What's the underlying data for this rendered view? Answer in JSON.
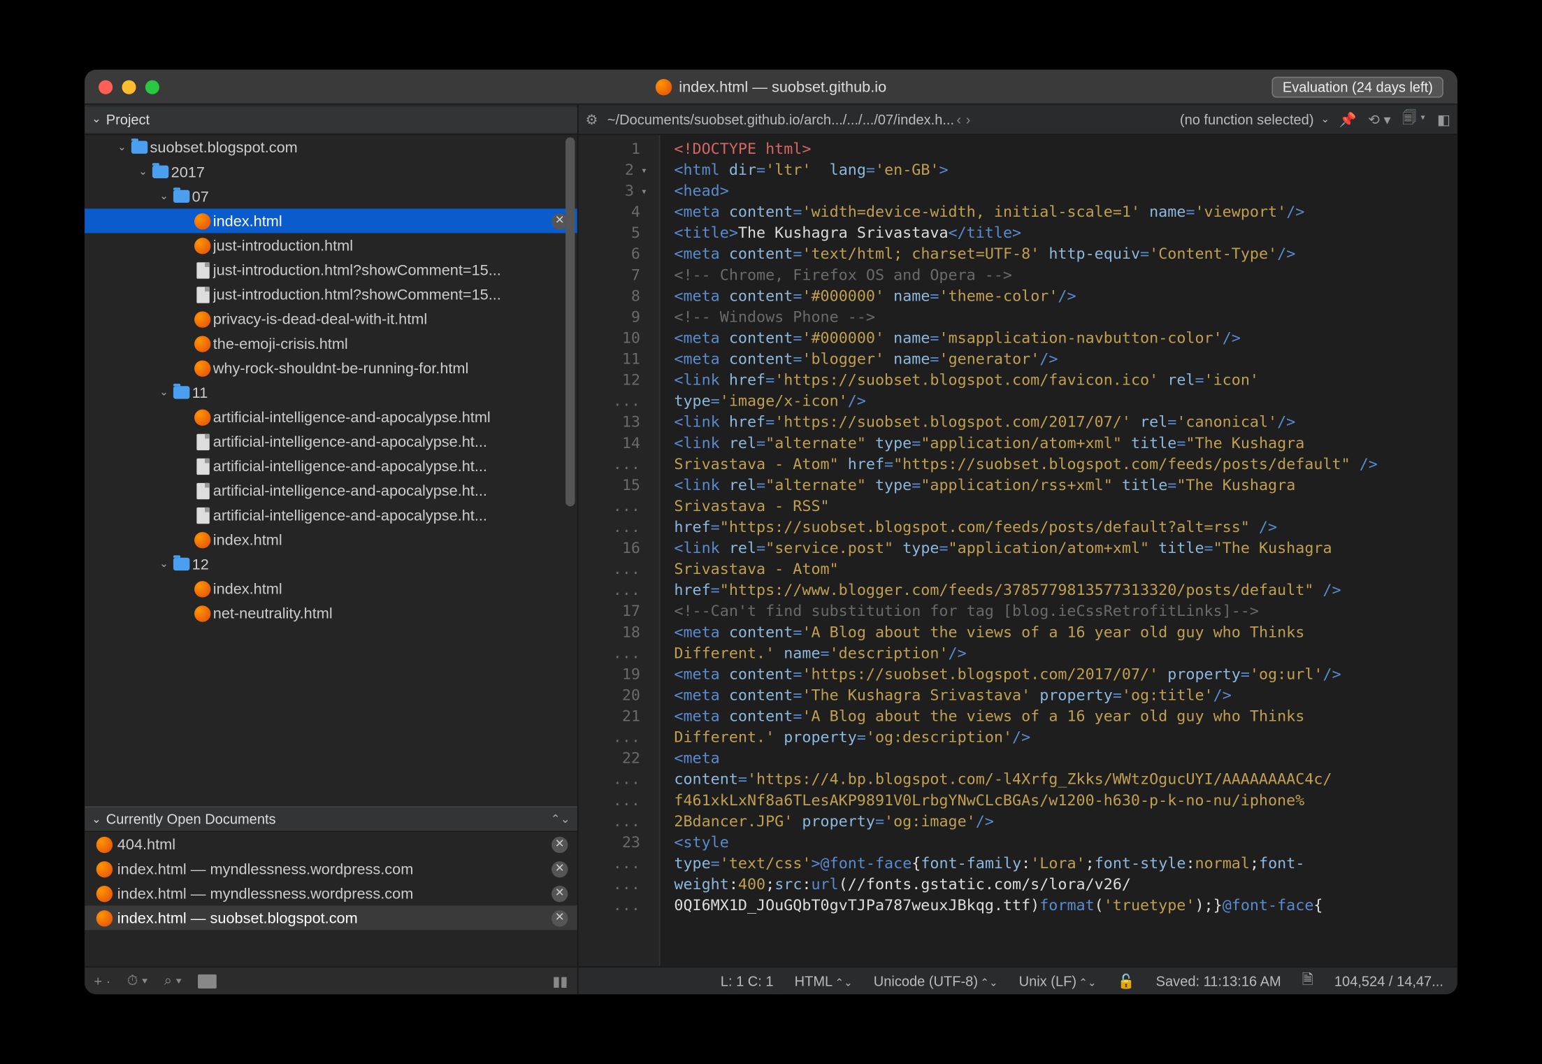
{
  "title": {
    "filename": "index.html",
    "project": "suobset.github.io"
  },
  "evaluation_badge": "Evaluation (24 days left)",
  "breadcrumb": "~/Documents/suobset.github.io/arch.../.../.../07/index.h...",
  "function_selector": "(no function selected)",
  "sidebar": {
    "project_label": "Project",
    "open_docs_label": "Currently Open Documents",
    "tree": [
      {
        "indent": 1,
        "type": "folder",
        "chev": "down",
        "label": "suobset.blogspot.com"
      },
      {
        "indent": 2,
        "type": "folder",
        "chev": "down",
        "label": "2017"
      },
      {
        "indent": 3,
        "type": "folder",
        "chev": "down",
        "label": "07"
      },
      {
        "indent": 4,
        "type": "html",
        "label": "index.html",
        "selected": true,
        "closeable": true
      },
      {
        "indent": 4,
        "type": "html",
        "label": "just-introduction.html"
      },
      {
        "indent": 4,
        "type": "file",
        "label": "just-introduction.html?showComment=15..."
      },
      {
        "indent": 4,
        "type": "file",
        "label": "just-introduction.html?showComment=15..."
      },
      {
        "indent": 4,
        "type": "html",
        "label": "privacy-is-dead-deal-with-it.html"
      },
      {
        "indent": 4,
        "type": "html",
        "label": "the-emoji-crisis.html"
      },
      {
        "indent": 4,
        "type": "html",
        "label": "why-rock-shouldnt-be-running-for.html"
      },
      {
        "indent": 3,
        "type": "folder",
        "chev": "down",
        "label": "11"
      },
      {
        "indent": 4,
        "type": "html",
        "label": "artificial-intelligence-and-apocalypse.html"
      },
      {
        "indent": 4,
        "type": "file",
        "label": "artificial-intelligence-and-apocalypse.ht..."
      },
      {
        "indent": 4,
        "type": "file",
        "label": "artificial-intelligence-and-apocalypse.ht..."
      },
      {
        "indent": 4,
        "type": "file",
        "label": "artificial-intelligence-and-apocalypse.ht..."
      },
      {
        "indent": 4,
        "type": "file",
        "label": "artificial-intelligence-and-apocalypse.ht..."
      },
      {
        "indent": 4,
        "type": "html",
        "label": "index.html"
      },
      {
        "indent": 3,
        "type": "folder",
        "chev": "down",
        "label": "12"
      },
      {
        "indent": 4,
        "type": "html",
        "label": "index.html"
      },
      {
        "indent": 4,
        "type": "html",
        "label": "net-neutrality.html"
      }
    ],
    "open_docs": [
      {
        "label": "404.html"
      },
      {
        "label": "index.html — myndlessness.wordpress.com"
      },
      {
        "label": "index.html — myndlessness.wordpress.com"
      },
      {
        "label": "index.html — suobset.blogspot.com",
        "active": true
      }
    ]
  },
  "gutter": [
    "1",
    "2",
    "3",
    "4",
    "5",
    "6",
    "7",
    "8",
    "9",
    "10",
    "11",
    "12",
    "...",
    "13",
    "14",
    "...",
    "15",
    "...",
    "...",
    "16",
    "...",
    "...",
    "17",
    "18",
    "...",
    "19",
    "20",
    "21",
    "...",
    "22",
    "...",
    "...",
    "...",
    "23",
    "...",
    "...",
    "..."
  ],
  "gutter_folds": {
    "1": true,
    "2": true
  },
  "code_lines": [
    [
      {
        "c": "c-doc",
        "t": "<!DOCTYPE html>"
      }
    ],
    [
      {
        "c": "c-tag",
        "t": "<html "
      },
      {
        "c": "c-attr",
        "t": "dir"
      },
      {
        "c": "c-tag",
        "t": "="
      },
      {
        "c": "c-str",
        "t": "'ltr'"
      },
      {
        "c": "c-tag",
        "t": "  "
      },
      {
        "c": "c-attr",
        "t": "lang"
      },
      {
        "c": "c-tag",
        "t": "="
      },
      {
        "c": "c-str",
        "t": "'en-GB'"
      },
      {
        "c": "c-tag",
        "t": ">"
      }
    ],
    [
      {
        "c": "c-tag",
        "t": "<head>"
      }
    ],
    [
      {
        "c": "c-tag",
        "t": "<meta "
      },
      {
        "c": "c-attr",
        "t": "content"
      },
      {
        "c": "c-tag",
        "t": "="
      },
      {
        "c": "c-str",
        "t": "'width=device-width, initial-scale=1'"
      },
      {
        "c": "c-tag",
        "t": " "
      },
      {
        "c": "c-attr",
        "t": "name"
      },
      {
        "c": "c-tag",
        "t": "="
      },
      {
        "c": "c-str",
        "t": "'viewport'"
      },
      {
        "c": "c-tag",
        "t": "/>"
      }
    ],
    [
      {
        "c": "c-tag",
        "t": "<title>"
      },
      {
        "c": "c-txt",
        "t": "The Kushagra Srivastava"
      },
      {
        "c": "c-tag",
        "t": "</title>"
      }
    ],
    [
      {
        "c": "c-tag",
        "t": "<meta "
      },
      {
        "c": "c-attr",
        "t": "content"
      },
      {
        "c": "c-tag",
        "t": "="
      },
      {
        "c": "c-str",
        "t": "'text/html; charset=UTF-8'"
      },
      {
        "c": "c-tag",
        "t": " "
      },
      {
        "c": "c-attr",
        "t": "http-equiv"
      },
      {
        "c": "c-tag",
        "t": "="
      },
      {
        "c": "c-str",
        "t": "'Content-Type'"
      },
      {
        "c": "c-tag",
        "t": "/>"
      }
    ],
    [
      {
        "c": "c-cmt",
        "t": "<!-- Chrome, Firefox OS and Opera -->"
      }
    ],
    [
      {
        "c": "c-tag",
        "t": "<meta "
      },
      {
        "c": "c-attr",
        "t": "content"
      },
      {
        "c": "c-tag",
        "t": "="
      },
      {
        "c": "c-str",
        "t": "'#000000'"
      },
      {
        "c": "c-tag",
        "t": " "
      },
      {
        "c": "c-attr",
        "t": "name"
      },
      {
        "c": "c-tag",
        "t": "="
      },
      {
        "c": "c-str",
        "t": "'theme-color'"
      },
      {
        "c": "c-tag",
        "t": "/>"
      }
    ],
    [
      {
        "c": "c-cmt",
        "t": "<!-- Windows Phone -->"
      }
    ],
    [
      {
        "c": "c-tag",
        "t": "<meta "
      },
      {
        "c": "c-attr",
        "t": "content"
      },
      {
        "c": "c-tag",
        "t": "="
      },
      {
        "c": "c-str",
        "t": "'#000000'"
      },
      {
        "c": "c-tag",
        "t": " "
      },
      {
        "c": "c-attr",
        "t": "name"
      },
      {
        "c": "c-tag",
        "t": "="
      },
      {
        "c": "c-str",
        "t": "'msapplication-navbutton-color'"
      },
      {
        "c": "c-tag",
        "t": "/>"
      }
    ],
    [
      {
        "c": "c-tag",
        "t": "<meta "
      },
      {
        "c": "c-attr",
        "t": "content"
      },
      {
        "c": "c-tag",
        "t": "="
      },
      {
        "c": "c-str",
        "t": "'blogger'"
      },
      {
        "c": "c-tag",
        "t": " "
      },
      {
        "c": "c-attr",
        "t": "name"
      },
      {
        "c": "c-tag",
        "t": "="
      },
      {
        "c": "c-str",
        "t": "'generator'"
      },
      {
        "c": "c-tag",
        "t": "/>"
      }
    ],
    [
      {
        "c": "c-tag",
        "t": "<link "
      },
      {
        "c": "c-attr",
        "t": "href"
      },
      {
        "c": "c-tag",
        "t": "="
      },
      {
        "c": "c-str",
        "t": "'https://suobset.blogspot.com/favicon.ico'"
      },
      {
        "c": "c-tag",
        "t": " "
      },
      {
        "c": "c-attr",
        "t": "rel"
      },
      {
        "c": "c-tag",
        "t": "="
      },
      {
        "c": "c-str",
        "t": "'icon'"
      },
      {
        "c": "c-tag",
        "t": " "
      }
    ],
    [
      {
        "c": "c-attr",
        "t": "type"
      },
      {
        "c": "c-tag",
        "t": "="
      },
      {
        "c": "c-str",
        "t": "'image/x-icon'"
      },
      {
        "c": "c-tag",
        "t": "/>"
      }
    ],
    [
      {
        "c": "c-tag",
        "t": "<link "
      },
      {
        "c": "c-attr",
        "t": "href"
      },
      {
        "c": "c-tag",
        "t": "="
      },
      {
        "c": "c-str",
        "t": "'https://suobset.blogspot.com/2017/07/'"
      },
      {
        "c": "c-tag",
        "t": " "
      },
      {
        "c": "c-attr",
        "t": "rel"
      },
      {
        "c": "c-tag",
        "t": "="
      },
      {
        "c": "c-str",
        "t": "'canonical'"
      },
      {
        "c": "c-tag",
        "t": "/>"
      }
    ],
    [
      {
        "c": "c-tag",
        "t": "<link "
      },
      {
        "c": "c-attr",
        "t": "rel"
      },
      {
        "c": "c-tag",
        "t": "="
      },
      {
        "c": "c-str",
        "t": "\"alternate\""
      },
      {
        "c": "c-tag",
        "t": " "
      },
      {
        "c": "c-attr",
        "t": "type"
      },
      {
        "c": "c-tag",
        "t": "="
      },
      {
        "c": "c-str",
        "t": "\"application/atom+xml\""
      },
      {
        "c": "c-tag",
        "t": " "
      },
      {
        "c": "c-attr",
        "t": "title"
      },
      {
        "c": "c-tag",
        "t": "="
      },
      {
        "c": "c-str",
        "t": "\"The Kushagra "
      }
    ],
    [
      {
        "c": "c-str",
        "t": "Srivastava - Atom\""
      },
      {
        "c": "c-tag",
        "t": " "
      },
      {
        "c": "c-attr",
        "t": "href"
      },
      {
        "c": "c-tag",
        "t": "="
      },
      {
        "c": "c-str",
        "t": "\"https://suobset.blogspot.com/feeds/posts/default\""
      },
      {
        "c": "c-tag",
        "t": " />"
      }
    ],
    [
      {
        "c": "c-tag",
        "t": "<link "
      },
      {
        "c": "c-attr",
        "t": "rel"
      },
      {
        "c": "c-tag",
        "t": "="
      },
      {
        "c": "c-str",
        "t": "\"alternate\""
      },
      {
        "c": "c-tag",
        "t": " "
      },
      {
        "c": "c-attr",
        "t": "type"
      },
      {
        "c": "c-tag",
        "t": "="
      },
      {
        "c": "c-str",
        "t": "\"application/rss+xml\""
      },
      {
        "c": "c-tag",
        "t": " "
      },
      {
        "c": "c-attr",
        "t": "title"
      },
      {
        "c": "c-tag",
        "t": "="
      },
      {
        "c": "c-str",
        "t": "\"The Kushagra "
      }
    ],
    [
      {
        "c": "c-str",
        "t": "Srivastava - RSS\""
      },
      {
        "c": "c-tag",
        "t": " "
      }
    ],
    [
      {
        "c": "c-attr",
        "t": "href"
      },
      {
        "c": "c-tag",
        "t": "="
      },
      {
        "c": "c-str",
        "t": "\"https://suobset.blogspot.com/feeds/posts/default?alt=rss\""
      },
      {
        "c": "c-tag",
        "t": " />"
      }
    ],
    [
      {
        "c": "c-tag",
        "t": "<link "
      },
      {
        "c": "c-attr",
        "t": "rel"
      },
      {
        "c": "c-tag",
        "t": "="
      },
      {
        "c": "c-str",
        "t": "\"service.post\""
      },
      {
        "c": "c-tag",
        "t": " "
      },
      {
        "c": "c-attr",
        "t": "type"
      },
      {
        "c": "c-tag",
        "t": "="
      },
      {
        "c": "c-str",
        "t": "\"application/atom+xml\""
      },
      {
        "c": "c-tag",
        "t": " "
      },
      {
        "c": "c-attr",
        "t": "title"
      },
      {
        "c": "c-tag",
        "t": "="
      },
      {
        "c": "c-str",
        "t": "\"The Kushagra "
      }
    ],
    [
      {
        "c": "c-str",
        "t": "Srivastava - Atom\""
      },
      {
        "c": "c-tag",
        "t": " "
      }
    ],
    [
      {
        "c": "c-attr",
        "t": "href"
      },
      {
        "c": "c-tag",
        "t": "="
      },
      {
        "c": "c-str",
        "t": "\"https://www.blogger.com/feeds/3785779813577313320/posts/default\""
      },
      {
        "c": "c-tag",
        "t": " />"
      }
    ],
    [
      {
        "c": "c-cmt",
        "t": "<!--Can't find substitution for tag [blog.ieCssRetrofitLinks]-->"
      }
    ],
    [
      {
        "c": "c-tag",
        "t": "<meta "
      },
      {
        "c": "c-attr",
        "t": "content"
      },
      {
        "c": "c-tag",
        "t": "="
      },
      {
        "c": "c-str",
        "t": "'A Blog about the views of a 16 year old guy who Thinks "
      }
    ],
    [
      {
        "c": "c-str",
        "t": "Different.'"
      },
      {
        "c": "c-tag",
        "t": " "
      },
      {
        "c": "c-attr",
        "t": "name"
      },
      {
        "c": "c-tag",
        "t": "="
      },
      {
        "c": "c-str",
        "t": "'description'"
      },
      {
        "c": "c-tag",
        "t": "/>"
      }
    ],
    [
      {
        "c": "c-tag",
        "t": "<meta "
      },
      {
        "c": "c-attr",
        "t": "content"
      },
      {
        "c": "c-tag",
        "t": "="
      },
      {
        "c": "c-str",
        "t": "'https://suobset.blogspot.com/2017/07/'"
      },
      {
        "c": "c-tag",
        "t": " "
      },
      {
        "c": "c-attr",
        "t": "property"
      },
      {
        "c": "c-tag",
        "t": "="
      },
      {
        "c": "c-str",
        "t": "'og:url'"
      },
      {
        "c": "c-tag",
        "t": "/>"
      }
    ],
    [
      {
        "c": "c-tag",
        "t": "<meta "
      },
      {
        "c": "c-attr",
        "t": "content"
      },
      {
        "c": "c-tag",
        "t": "="
      },
      {
        "c": "c-str",
        "t": "'The Kushagra Srivastava'"
      },
      {
        "c": "c-tag",
        "t": " "
      },
      {
        "c": "c-attr",
        "t": "property"
      },
      {
        "c": "c-tag",
        "t": "="
      },
      {
        "c": "c-str",
        "t": "'og:title'"
      },
      {
        "c": "c-tag",
        "t": "/>"
      }
    ],
    [
      {
        "c": "c-tag",
        "t": "<meta "
      },
      {
        "c": "c-attr",
        "t": "content"
      },
      {
        "c": "c-tag",
        "t": "="
      },
      {
        "c": "c-str",
        "t": "'A Blog about the views of a 16 year old guy who Thinks "
      }
    ],
    [
      {
        "c": "c-str",
        "t": "Different.'"
      },
      {
        "c": "c-tag",
        "t": " "
      },
      {
        "c": "c-attr",
        "t": "property"
      },
      {
        "c": "c-tag",
        "t": "="
      },
      {
        "c": "c-str",
        "t": "'og:description'"
      },
      {
        "c": "c-tag",
        "t": "/>"
      }
    ],
    [
      {
        "c": "c-tag",
        "t": "<meta "
      }
    ],
    [
      {
        "c": "c-attr",
        "t": "content"
      },
      {
        "c": "c-tag",
        "t": "="
      },
      {
        "c": "c-str",
        "t": "'https://4.bp.blogspot.com/-l4Xrfg_Zkks/WWtzOgucUYI/AAAAAAAAC4c/"
      }
    ],
    [
      {
        "c": "c-str",
        "t": "f461xkLxNf8a6TLesAKP9891V0LrbgYNwCLcBGAs/w1200-h630-p-k-no-nu/iphone%"
      }
    ],
    [
      {
        "c": "c-str",
        "t": "2Bdancer.JPG'"
      },
      {
        "c": "c-tag",
        "t": " "
      },
      {
        "c": "c-attr",
        "t": "property"
      },
      {
        "c": "c-tag",
        "t": "="
      },
      {
        "c": "c-str",
        "t": "'og:image'"
      },
      {
        "c": "c-tag",
        "t": "/>"
      }
    ],
    [
      {
        "c": "c-tag",
        "t": "<style "
      }
    ],
    [
      {
        "c": "c-attr",
        "t": "type"
      },
      {
        "c": "c-tag",
        "t": "="
      },
      {
        "c": "c-str",
        "t": "'text/css'"
      },
      {
        "c": "c-tag",
        "t": ">"
      },
      {
        "c": "c-css-func",
        "t": "@font-face"
      },
      {
        "c": "c-txt",
        "t": "{"
      },
      {
        "c": "c-css-prop",
        "t": "font-family"
      },
      {
        "c": "c-txt",
        "t": ":"
      },
      {
        "c": "c-str",
        "t": "'Lora'"
      },
      {
        "c": "c-txt",
        "t": ";"
      },
      {
        "c": "c-css-prop",
        "t": "font-style"
      },
      {
        "c": "c-txt",
        "t": ":"
      },
      {
        "c": "c-css-val",
        "t": "normal"
      },
      {
        "c": "c-txt",
        "t": ";"
      },
      {
        "c": "c-css-prop",
        "t": "font-"
      }
    ],
    [
      {
        "c": "c-css-prop",
        "t": "weight"
      },
      {
        "c": "c-txt",
        "t": ":"
      },
      {
        "c": "c-css-val",
        "t": "400"
      },
      {
        "c": "c-txt",
        "t": ";"
      },
      {
        "c": "c-css-prop",
        "t": "src"
      },
      {
        "c": "c-txt",
        "t": ":"
      },
      {
        "c": "c-css-func",
        "t": "url"
      },
      {
        "c": "c-txt",
        "t": "(//fonts.gstatic.com/s/lora/v26/"
      }
    ],
    [
      {
        "c": "c-txt",
        "t": "0QI6MX1D_JOuGQbT0gvTJPa787weuxJBkqg.ttf)"
      },
      {
        "c": "c-css-func",
        "t": "format"
      },
      {
        "c": "c-txt",
        "t": "("
      },
      {
        "c": "c-str",
        "t": "'truetype'"
      },
      {
        "c": "c-txt",
        "t": ");}"
      },
      {
        "c": "c-css-func",
        "t": "@font-face"
      },
      {
        "c": "c-txt",
        "t": "{"
      }
    ]
  ],
  "statusbar": {
    "cursor": "L: 1 C: 1",
    "language": "HTML",
    "encoding": "Unicode (UTF-8)",
    "line_endings": "Unix (LF)",
    "saved": "Saved: 11:13:16 AM",
    "size": "104,524 / 14,47..."
  }
}
